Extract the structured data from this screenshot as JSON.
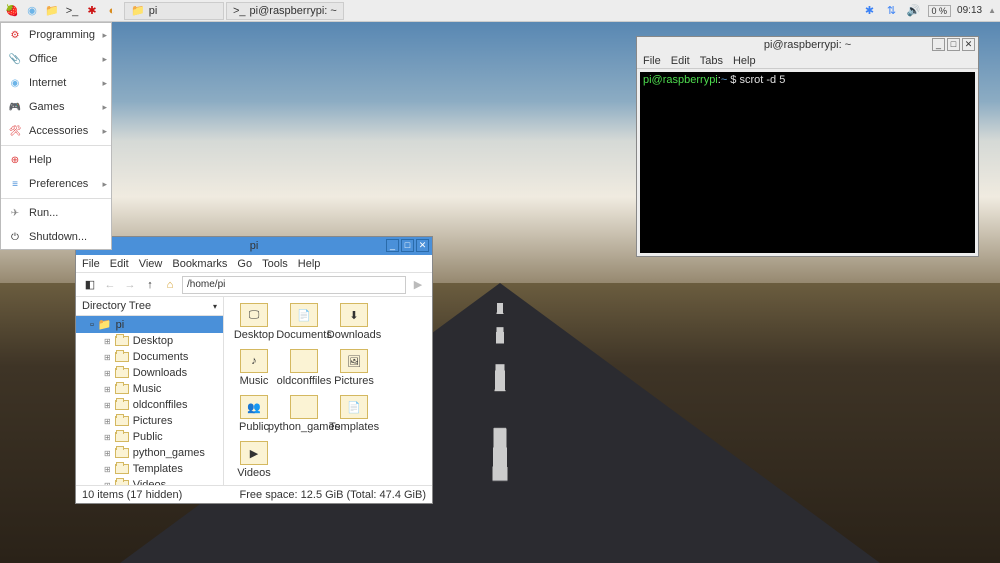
{
  "taskbar": {
    "apps": [
      {
        "name": "raspberry-menu",
        "glyph": "🍓",
        "color": "#c51d4a"
      },
      {
        "name": "globe",
        "glyph": "◉",
        "color": "#6cb4e8"
      },
      {
        "name": "file-manager",
        "glyph": "📁",
        "color": "#ddb84a"
      },
      {
        "name": "terminal",
        "glyph": ">_",
        "color": "#333"
      },
      {
        "name": "mathematica-red",
        "glyph": "✱",
        "color": "#c11"
      },
      {
        "name": "mathematica-orange",
        "glyph": "◐",
        "color": "#d88a1a"
      }
    ],
    "windows": [
      {
        "icon": "📁",
        "label": "pi"
      },
      {
        "icon": ">_",
        "label": "pi@raspberrypi: ~"
      }
    ],
    "tray": {
      "bluetooth": "✱",
      "net": "⇅",
      "sound": "🔊",
      "battery": "0 %",
      "clock": "09:13"
    }
  },
  "startmenu": [
    {
      "icon": "⚙",
      "color": "#d33",
      "label": "Programming",
      "sub": true
    },
    {
      "icon": "📎",
      "color": "#d33",
      "label": "Office",
      "sub": true
    },
    {
      "icon": "◉",
      "color": "#6cb4e8",
      "label": "Internet",
      "sub": true
    },
    {
      "icon": "🎮",
      "color": "#3a3",
      "label": "Games",
      "sub": true
    },
    {
      "icon": "🛠",
      "color": "#d33",
      "label": "Accessories",
      "sub": true
    },
    {
      "icon": "⊕",
      "color": "#d33",
      "label": "Help",
      "sub": false
    },
    {
      "icon": "≡",
      "color": "#4a90d9",
      "label": "Preferences",
      "sub": true
    },
    {
      "icon": "✈",
      "color": "#888",
      "label": "Run...",
      "sub": false
    },
    {
      "icon": "⏻",
      "color": "#333",
      "label": "Shutdown...",
      "sub": false
    }
  ],
  "fm": {
    "title": "pi",
    "menu": [
      "File",
      "Edit",
      "View",
      "Bookmarks",
      "Go",
      "Tools",
      "Help"
    ],
    "path": "/home/pi",
    "tree_head": "Directory Tree",
    "tree_sel": "pi",
    "tree": [
      "Desktop",
      "Documents",
      "Downloads",
      "Music",
      "oldconffiles",
      "Pictures",
      "Public",
      "python_games",
      "Templates",
      "Videos"
    ],
    "root": "/",
    "icons": [
      "Desktop",
      "Documents",
      "Downloads",
      "Music",
      "oldconffiles",
      "Pictures",
      "Public",
      "python_games",
      "Templates",
      "Videos"
    ],
    "status_left": "10 items (17 hidden)",
    "status_right": "Free space: 12.5 GiB (Total: 47.4 GiB)"
  },
  "term": {
    "title": "pi@raspberrypi: ~",
    "menu": [
      "File",
      "Edit",
      "Tabs",
      "Help"
    ],
    "prompt_user": "pi@raspberrypi",
    "prompt_sep": ":",
    "prompt_path": "~",
    "prompt_dollar": " $ ",
    "cmd": "scrot -d 5"
  }
}
